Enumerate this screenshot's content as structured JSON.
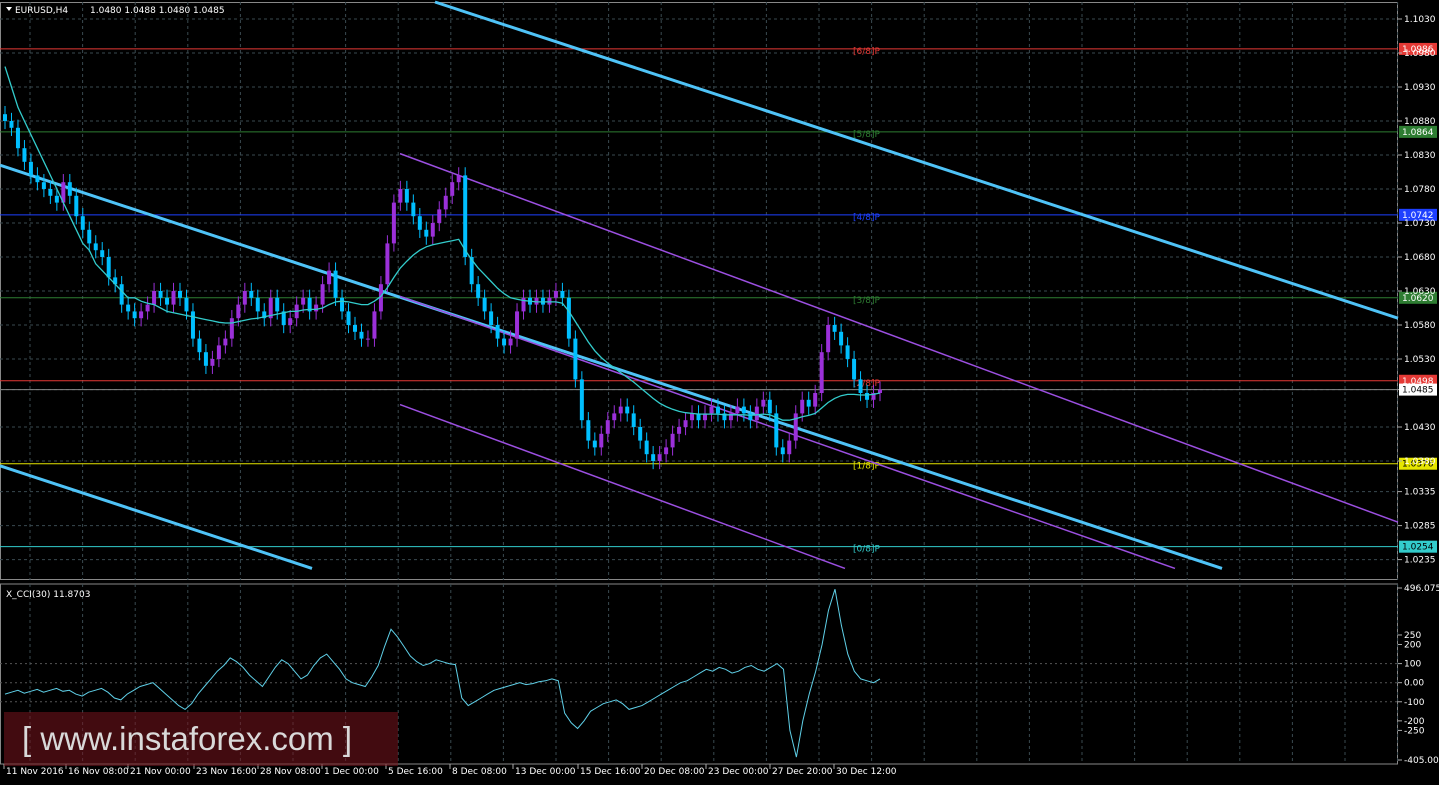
{
  "header": {
    "symbol_text": "EURUSD,H4",
    "ohlc_text": "1.0480 1.0488 1.0480 1.0485",
    "indicator_text": "X_CCI(30) 11.8703"
  },
  "watermark": {
    "text": "[ www.instaforex.com ]"
  },
  "colors": {
    "background": "#000000",
    "candle_up": "#9b30d9",
    "candle_down": "#00bfff",
    "ma": "#33cccc",
    "channel_main": "#4fc3f7",
    "channel_secondary": "#9b4fe0",
    "grid": "#3a4a50",
    "cci": "#5fd0e8"
  },
  "chart_data": [
    {
      "type": "candlestick",
      "title": "",
      "ylim": [
        1.0205,
        1.1055
      ],
      "y_ticks": [
        "1.1030",
        "1.0980",
        "1.0930",
        "1.0880",
        "1.0830",
        "1.0780",
        "1.0730",
        "1.0680",
        "1.0630",
        "1.0580",
        "1.0530",
        "1.0485",
        "1.0430",
        "1.0380",
        "1.0335",
        "1.0285",
        "1.0235"
      ],
      "x_ticks": [
        "11 Nov 2016",
        "16 Nov 08:00",
        "21 Nov 00:00",
        "23 Nov 16:00",
        "28 Nov 08:00",
        "1 Dec 00:00",
        "5 Dec 16:00",
        "8 Dec 08:00",
        "13 Dec 00:00",
        "15 Dec 16:00",
        "20 Dec 08:00",
        "23 Dec 00:00",
        "27 Dec 20:00",
        "30 Dec 12:00"
      ],
      "current_price": "1.0485",
      "murrey_levels": [
        {
          "label": "[6/8]P",
          "price": "1.0986",
          "value": 1.0986,
          "color": "#e53935"
        },
        {
          "label": "[5/8]P",
          "price": "1.0864",
          "value": 1.0864,
          "color": "#2e7d32"
        },
        {
          "label": "[4/8]P",
          "price": "1.0742",
          "value": 1.0742,
          "color": "#1e40ff"
        },
        {
          "label": "[3/8]P",
          "price": "1.0620",
          "value": 1.062,
          "color": "#2e7d32"
        },
        {
          "label": "[2/8]P",
          "price": "1.0498",
          "value": 1.0498,
          "color": "#e53935"
        },
        {
          "label": "[1/8]P",
          "price": "1.0376",
          "value": 1.0376,
          "color": "#e6e600"
        },
        {
          "label": "[0/8]P",
          "price": "1.0254",
          "value": 1.0254,
          "color": "#33cccc"
        }
      ],
      "close_series": [
        1.088,
        1.087,
        1.084,
        1.082,
        1.08,
        1.079,
        1.078,
        1.077,
        1.076,
        1.079,
        1.077,
        1.074,
        1.072,
        1.07,
        1.069,
        1.068,
        1.065,
        1.064,
        1.061,
        1.06,
        1.059,
        1.06,
        1.061,
        1.063,
        1.062,
        1.061,
        1.063,
        1.062,
        1.06,
        1.056,
        1.054,
        1.052,
        1.053,
        1.055,
        1.056,
        1.059,
        1.061,
        1.063,
        1.062,
        1.06,
        1.059,
        1.062,
        1.06,
        1.058,
        1.059,
        1.061,
        1.062,
        1.06,
        1.061,
        1.064,
        1.066,
        1.062,
        1.06,
        1.058,
        1.057,
        1.056,
        1.056,
        1.06,
        1.064,
        1.07,
        1.076,
        1.078,
        1.076,
        1.074,
        1.072,
        1.071,
        1.073,
        1.075,
        1.077,
        1.079,
        1.08,
        1.068,
        1.064,
        1.062,
        1.06,
        1.058,
        1.056,
        1.055,
        1.056,
        1.06,
        1.062,
        1.061,
        1.062,
        1.061,
        1.062,
        1.063,
        1.062,
        1.056,
        1.05,
        1.044,
        1.041,
        1.04,
        1.042,
        1.044,
        1.045,
        1.046,
        1.045,
        1.043,
        1.041,
        1.039,
        1.038,
        1.039,
        1.04,
        1.042,
        1.043,
        1.044,
        1.045,
        1.044,
        1.045,
        1.046,
        1.045,
        1.044,
        1.045,
        1.046,
        1.045,
        1.044,
        1.046,
        1.047,
        1.045,
        1.04,
        1.039,
        1.041,
        1.045,
        1.047,
        1.046,
        1.048,
        1.054,
        1.058,
        1.057,
        1.055,
        1.053,
        1.05,
        1.048,
        1.047,
        1.048,
        1.0485
      ],
      "ma_series": [
        1.096,
        1.093,
        1.09,
        1.088,
        1.086,
        1.084,
        1.082,
        1.08,
        1.078,
        1.076,
        1.074,
        1.072,
        1.07,
        1.069,
        1.067,
        1.066,
        1.065,
        1.064,
        1.063,
        1.062,
        1.062,
        1.0615,
        1.0612,
        1.061,
        1.0605,
        1.06,
        1.0598,
        1.0596,
        1.0594,
        1.0592,
        1.059,
        1.0588,
        1.0586,
        1.0584,
        1.0583,
        1.0583,
        1.0585,
        1.0587,
        1.0589,
        1.059,
        1.0592,
        1.0594,
        1.0596,
        1.0598,
        1.06,
        1.06,
        1.0602,
        1.0603,
        1.0603,
        1.0605,
        1.061,
        1.0614,
        1.0615,
        1.0614,
        1.0612,
        1.061,
        1.061,
        1.0615,
        1.0622,
        1.0635,
        1.065,
        1.0664,
        1.0674,
        1.0683,
        1.069,
        1.0695,
        1.0698,
        1.07,
        1.0702,
        1.0704,
        1.0706,
        1.069,
        1.0676,
        1.0664,
        1.0654,
        1.0644,
        1.0634,
        1.0626,
        1.062,
        1.0618,
        1.0616,
        1.0615,
        1.0614,
        1.0614,
        1.0614,
        1.0614,
        1.0612,
        1.06,
        1.0585,
        1.057,
        1.0555,
        1.0542,
        1.0532,
        1.0524,
        1.0517,
        1.051,
        1.0503,
        1.0496,
        1.0488,
        1.048,
        1.0472,
        1.0465,
        1.046,
        1.0456,
        1.0453,
        1.0451,
        1.045,
        1.0449,
        1.0449,
        1.0449,
        1.0449,
        1.0448,
        1.0448,
        1.0448,
        1.0448,
        1.0447,
        1.0448,
        1.0449,
        1.0448,
        1.0444,
        1.044,
        1.044,
        1.0442,
        1.0445,
        1.0447,
        1.045,
        1.0458,
        1.0466,
        1.0472,
        1.0476,
        1.0478,
        1.0478,
        1.0477,
        1.0477,
        1.0478,
        1.048
      ]
    },
    {
      "type": "line",
      "title": "",
      "ylim": [
        -405.009,
        496.0751
      ],
      "y_ticks": [
        "496.0751",
        "250",
        "200",
        "100",
        "0.00",
        "-100",
        "-200",
        "-250",
        "-405.009"
      ],
      "series": [
        {
          "values": [
            -60,
            -50,
            -40,
            -55,
            -45,
            -35,
            -50,
            -40,
            -30,
            -45,
            -40,
            -60,
            -70,
            -50,
            -40,
            -30,
            -50,
            -80,
            -90,
            -60,
            -40,
            -20,
            -10,
            0,
            -30,
            -60,
            -90,
            -120,
            -140,
            -110,
            -60,
            -20,
            20,
            60,
            90,
            130,
            110,
            80,
            40,
            10,
            -20,
            30,
            80,
            120,
            100,
            60,
            20,
            40,
            90,
            130,
            150,
            110,
            70,
            20,
            0,
            -10,
            -20,
            30,
            90,
            190,
            280,
            240,
            190,
            140,
            110,
            90,
            100,
            120,
            110,
            100,
            95,
            -80,
            -120,
            -100,
            -80,
            -60,
            -40,
            -30,
            -20,
            -10,
            0,
            -10,
            -5,
            5,
            10,
            20,
            10,
            -160,
            -210,
            -240,
            -200,
            -150,
            -130,
            -110,
            -100,
            -90,
            -110,
            -140,
            -130,
            -120,
            -100,
            -80,
            -60,
            -40,
            -20,
            0,
            10,
            30,
            50,
            70,
            60,
            80,
            70,
            50,
            60,
            80,
            90,
            70,
            60,
            80,
            100,
            70,
            -250,
            -390,
            -200,
            -60,
            60,
            200,
            380,
            490,
            300,
            150,
            60,
            20,
            10,
            0,
            20
          ]
        }
      ]
    }
  ]
}
